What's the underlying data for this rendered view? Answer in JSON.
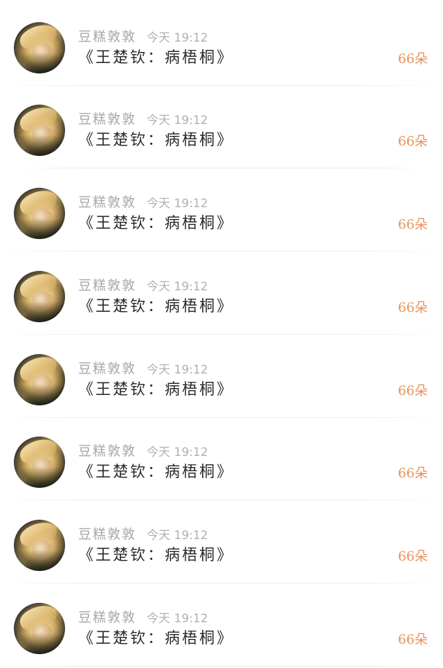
{
  "items": [
    {
      "name": "豆糕敦敦",
      "time": "今天 19:12",
      "title": "《王楚钦：病梧桐》",
      "count": "66朵",
      "avatar": "user-avatar-photo"
    },
    {
      "name": "豆糕敦敦",
      "time": "今天 19:12",
      "title": "《王楚钦：病梧桐》",
      "count": "66朵",
      "avatar": "user-avatar-photo"
    },
    {
      "name": "豆糕敦敦",
      "time": "今天 19:12",
      "title": "《王楚钦：病梧桐》",
      "count": "66朵",
      "avatar": "user-avatar-photo"
    },
    {
      "name": "豆糕敦敦",
      "time": "今天 19:12",
      "title": "《王楚钦：病梧桐》",
      "count": "66朵",
      "avatar": "user-avatar-photo"
    },
    {
      "name": "豆糕敦敦",
      "time": "今天 19:12",
      "title": "《王楚钦：病梧桐》",
      "count": "66朵",
      "avatar": "user-avatar-photo"
    },
    {
      "name": "豆糕敦敦",
      "time": "今天 19:12",
      "title": "《王楚钦：病梧桐》",
      "count": "66朵",
      "avatar": "user-avatar-photo"
    },
    {
      "name": "豆糕敦敦",
      "time": "今天 19:12",
      "title": "《王楚钦：病梧桐》",
      "count": "66朵",
      "avatar": "user-avatar-photo"
    },
    {
      "name": "豆糕敦敦",
      "time": "今天 19:12",
      "title": "《王楚钦：病梧桐》",
      "count": "66朵",
      "avatar": "user-avatar-photo"
    }
  ],
  "colors": {
    "name": "#a8a8a8",
    "time": "#b0b0b0",
    "title": "#2b2b2b",
    "count": "#e8925a",
    "divider": "#ececec",
    "background": "#ffffff"
  }
}
